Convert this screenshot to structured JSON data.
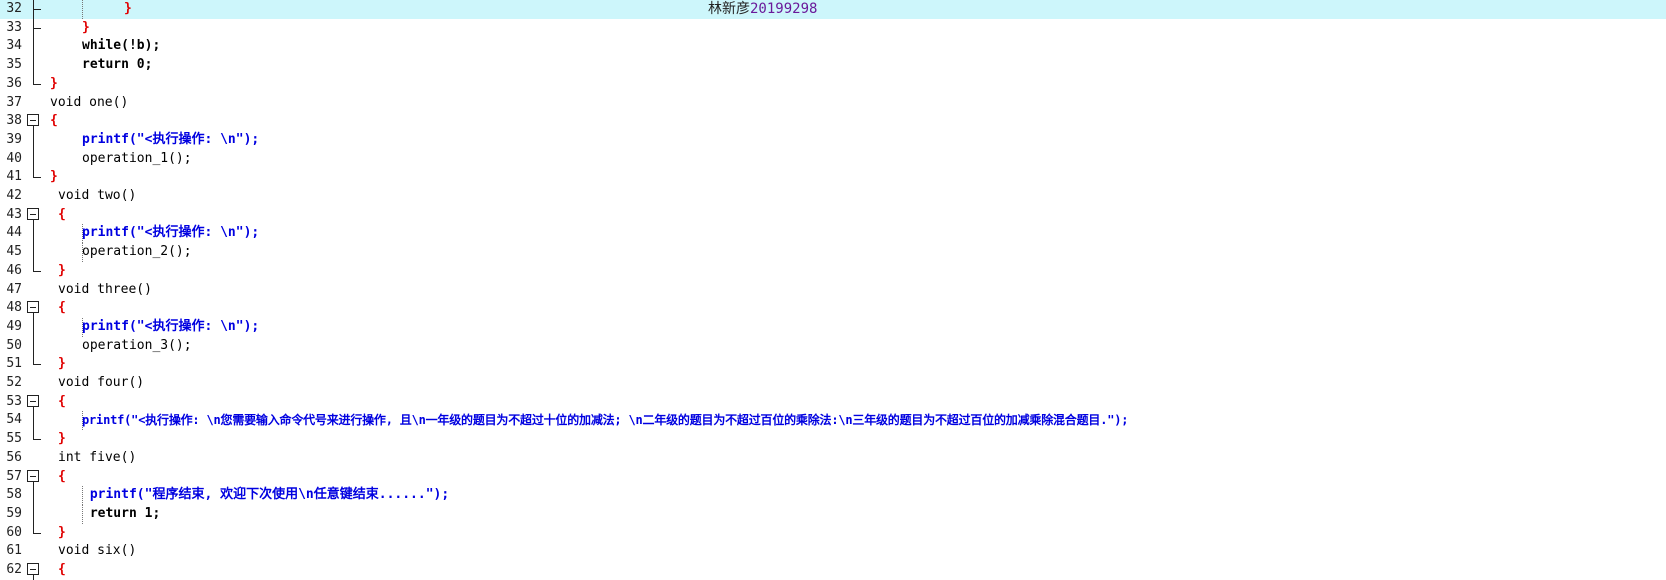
{
  "editor": {
    "watermark_name": "林新彦",
    "watermark_id": "20199298",
    "lines": [
      {
        "n": "32",
        "text": "}"
      },
      {
        "n": "33",
        "text": "}"
      },
      {
        "n": "34",
        "text": "while(!b);"
      },
      {
        "n": "35",
        "text": "return 0;"
      },
      {
        "n": "36",
        "text": "}"
      },
      {
        "n": "37",
        "text": "void one()"
      },
      {
        "n": "38",
        "text": "{"
      },
      {
        "n": "39",
        "text": "printf(\"<执行操作: \\n\");"
      },
      {
        "n": "40",
        "text": "operation_1();"
      },
      {
        "n": "41",
        "text": "}"
      },
      {
        "n": "42",
        "text": "void two()"
      },
      {
        "n": "43",
        "text": "{"
      },
      {
        "n": "44",
        "text": "printf(\"<执行操作: \\n\");"
      },
      {
        "n": "45",
        "text": "operation_2();"
      },
      {
        "n": "46",
        "text": "}"
      },
      {
        "n": "47",
        "text": "void three()"
      },
      {
        "n": "48",
        "text": "{"
      },
      {
        "n": "49",
        "text": "printf(\"<执行操作: \\n\");"
      },
      {
        "n": "50",
        "text": "operation_3();"
      },
      {
        "n": "51",
        "text": "}"
      },
      {
        "n": "52",
        "text": "void four()"
      },
      {
        "n": "53",
        "text": "{"
      },
      {
        "n": "54",
        "text": "printf(\"<执行操作: \\n您需要输入命令代号来进行操作, 且\\n一年级的题目为不超过十位的加减法; \\n二年级的题目为不超过百位的乘除法:\\n三年级的题目为不超过百位的加减乘除混合题目.\");"
      },
      {
        "n": "55",
        "text": "}"
      },
      {
        "n": "56",
        "text": "int five()"
      },
      {
        "n": "57",
        "text": "{"
      },
      {
        "n": "58",
        "text": "printf(\"程序结束, 欢迎下次使用\\n任意键结束......\");"
      },
      {
        "n": "59",
        "text": "return 1;"
      },
      {
        "n": "60",
        "text": "}"
      },
      {
        "n": "61",
        "text": "void six()"
      },
      {
        "n": "62",
        "text": "{"
      }
    ]
  }
}
